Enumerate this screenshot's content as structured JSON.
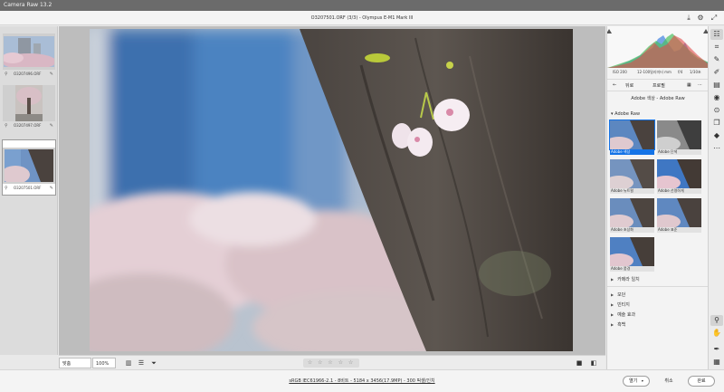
{
  "app": {
    "title": "Camera Raw 13.2"
  },
  "header": {
    "document_title": "O3207501.ORF (3/3)  -  Olympus E-M1 Mark III"
  },
  "filmstrip": {
    "items": [
      {
        "name": "O3207496.ORF"
      },
      {
        "name": "O3207497.ORF"
      },
      {
        "name": "O3207501.ORF"
      }
    ]
  },
  "canvas_toolbar": {
    "zoom_fit": "맞춤(24.7%)",
    "zoom_percent": "100%",
    "stars": "☆ ☆ ☆ ☆ ☆"
  },
  "status": {
    "image_info": "sRGB IEC61966-2.1 - 8비트 - 5184 x 3456(17.9MP) - 300 픽셀/인치",
    "open_label": "열기",
    "cancel_label": "취소",
    "done_label": "완료"
  },
  "panel": {
    "meta": {
      "iso": "ISO 200",
      "lens": "12-100밀리미터 mm",
      "aperture": "f/4",
      "shutter": "1/30초"
    },
    "nav": {
      "back": "뒤로",
      "title": "프로필"
    },
    "profile_group_title": "Adobe 색상 - Adobe Raw",
    "group_label": "Adobe Raw",
    "profiles": [
      {
        "label": "Adobe 색상"
      },
      {
        "label": "Adobe 단색"
      },
      {
        "label": "Adobe 뉴트럴"
      },
      {
        "label": "Adobe 선명하게"
      },
      {
        "label": "Adobe 초상화"
      },
      {
        "label": "Adobe 표준"
      },
      {
        "label": "Adobe 풍경"
      }
    ],
    "sections": [
      {
        "label": "카메라 일치"
      },
      {
        "label": "모던"
      },
      {
        "label": "빈티지"
      },
      {
        "label": "예술 효과"
      },
      {
        "label": "흑백"
      }
    ]
  },
  "colors": {
    "accent": "#1473e6",
    "histogram_red": "#e14b4b",
    "histogram_green": "#4bbf60",
    "histogram_blue": "#3f82e0"
  }
}
